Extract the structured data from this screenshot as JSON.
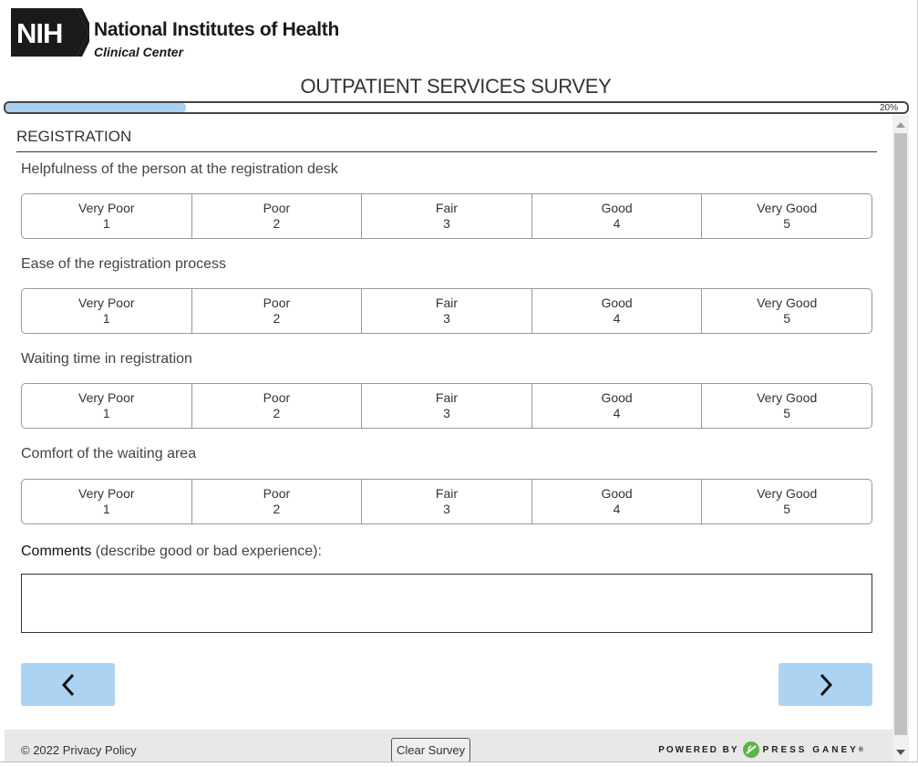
{
  "brand": {
    "logo_text": "NIH",
    "institute": "National Institutes of Health",
    "subtitle": "Clinical Center"
  },
  "survey_title": "OUTPATIENT SERVICES SURVEY",
  "progress": {
    "percent_label": "20%",
    "value": 0.2
  },
  "section_title": "REGISTRATION",
  "questions": [
    {
      "text": "Helpfulness of the person at the registration desk"
    },
    {
      "text": "Ease of the registration process"
    },
    {
      "text": "Waiting time in registration"
    },
    {
      "text": "Comfort of the waiting area"
    }
  ],
  "scale_options": [
    {
      "label": "Very Poor",
      "value": "1"
    },
    {
      "label": "Poor",
      "value": "2"
    },
    {
      "label": "Fair",
      "value": "3"
    },
    {
      "label": "Good",
      "value": "4"
    },
    {
      "label": "Very Good",
      "value": "5"
    }
  ],
  "comments": {
    "label_bold": "Comments",
    "label_rest": " (describe good or bad experience):",
    "value": ""
  },
  "nav": {
    "prev_icon": "chevron-left-icon",
    "next_icon": "chevron-right-icon"
  },
  "footer": {
    "copyright": "© 2022 Privacy Policy",
    "clear_label": "Clear Survey",
    "powered_by": "POWERED BY",
    "vendor": "PRESS GANEY",
    "vendor_mark": "®"
  },
  "colors": {
    "accent": "#acd4f2",
    "progress_fill": "#a9d1ef",
    "vendor_green": "#5ab645"
  }
}
